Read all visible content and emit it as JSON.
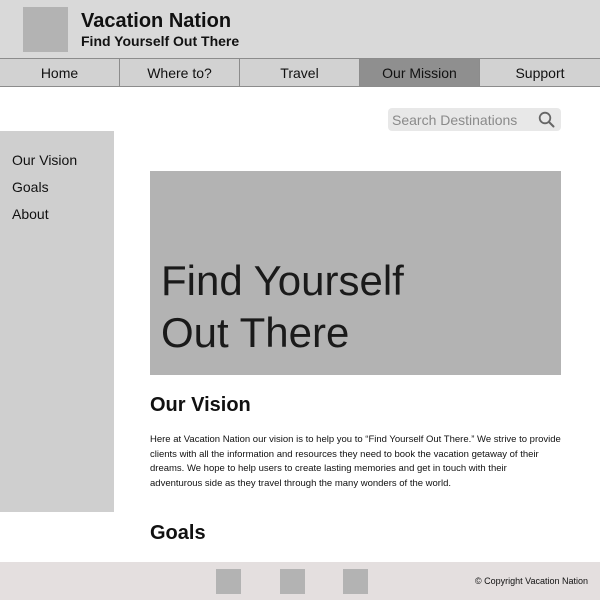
{
  "brand": {
    "title": "Vacation Nation",
    "tagline": "Find Yourself Out There"
  },
  "nav": {
    "items": [
      {
        "label": "Home",
        "active": false
      },
      {
        "label": "Where to?",
        "active": false
      },
      {
        "label": "Travel",
        "active": false
      },
      {
        "label": "Our Mission",
        "active": true
      },
      {
        "label": "Support",
        "active": false
      }
    ]
  },
  "search": {
    "placeholder": "Search Destinations",
    "icon": "search-icon"
  },
  "sidebar": {
    "items": [
      {
        "label": "Our Vision"
      },
      {
        "label": "Goals"
      },
      {
        "label": "About"
      }
    ]
  },
  "hero": {
    "line1": "Find Yourself",
    "line2": "Out There"
  },
  "main": {
    "vision_title": "Our Vision",
    "vision_text": "Here at Vacation Nation our vision is to help you to “Find Yourself Out There.” We strive to provide clients with all the information and resources they need to book the vacation getaway of their dreams. We hope to help users to create lasting memories and get in touch with their adventurous side as they travel through the many wonders of the world.",
    "goals_title": "Goals"
  },
  "footer": {
    "copyright": "© Copyright Vacation Nation",
    "social_icons": [
      "social-icon",
      "social-icon",
      "social-icon"
    ]
  },
  "colors": {
    "header_bg": "#d9d9d9",
    "nav_active_bg": "#8f8f8f",
    "sidebar_bg": "#cfcfcf",
    "hero_bg": "#b3b3b3",
    "footer_bg": "#e4dfdf"
  }
}
